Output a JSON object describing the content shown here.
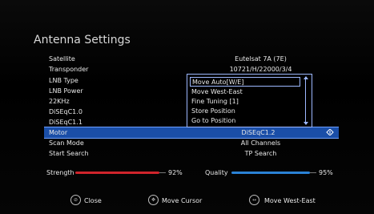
{
  "title": "Antenna Settings",
  "settings": [
    {
      "label": "Satellite",
      "value": "Eutelsat 7A (7E)"
    },
    {
      "label": "Transponder",
      "value": "10721/H/22000/3/4"
    },
    {
      "label": "LNB Type",
      "value": ""
    },
    {
      "label": "LNB Power",
      "value": ""
    },
    {
      "label": "22KHz",
      "value": ""
    },
    {
      "label": "DiSEqC1.0",
      "value": ""
    },
    {
      "label": "DiSEqC1.1",
      "value": ""
    },
    {
      "label": "Motor",
      "value": "DiSEqC1.2"
    },
    {
      "label": "Scan Mode",
      "value": "All Channels"
    },
    {
      "label": "Start Search",
      "value": "TP Search"
    }
  ],
  "dropdown": {
    "options": [
      "Move Auto[W/E]",
      "Move West-East",
      "Fine Tuning [1]",
      "Store Position",
      "Go to Position"
    ],
    "highlighted_index": 0
  },
  "meters": {
    "strength": {
      "label": "Strength",
      "value": 0.92,
      "text": "92%",
      "color": "#d0242b"
    },
    "quality": {
      "label": "Quality",
      "value": 0.95,
      "text": "95%",
      "color": "#2a82d6"
    }
  },
  "footer": {
    "close": "Close",
    "move_cursor": "Move Cursor",
    "move_west_east": "Move West-East"
  },
  "colors": {
    "selection": "#1a4ea8",
    "accent_border": "#9db8ff"
  }
}
